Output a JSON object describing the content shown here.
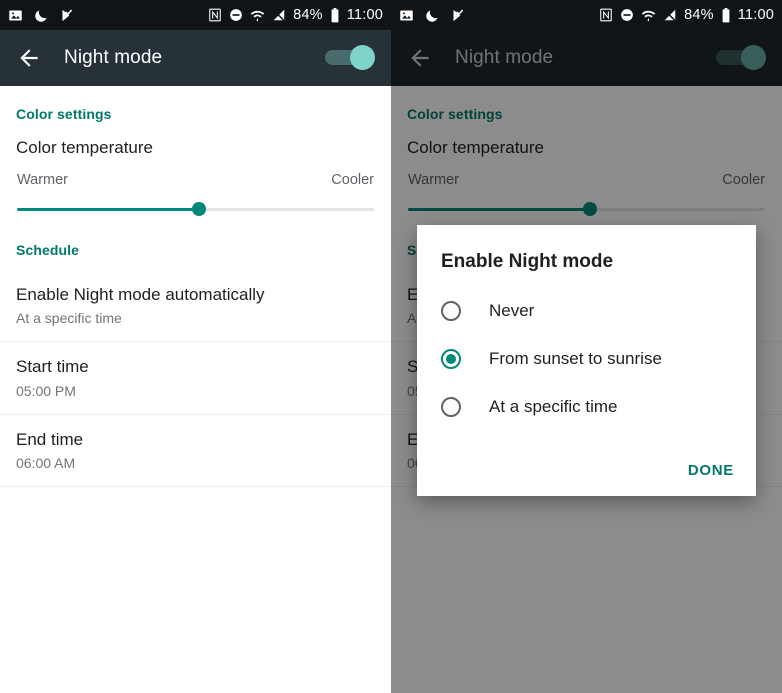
{
  "status_bar": {
    "left_icons": [
      "image-icon",
      "moon-icon",
      "flag-check-icon"
    ],
    "right_icons": [
      "nfc-icon",
      "do-not-disturb-icon",
      "wifi-icon",
      "signal-off-icon"
    ],
    "battery_percent": "84%",
    "battery_icon": "battery-icon",
    "time": "11:00"
  },
  "app_bar": {
    "back_icon": "back-arrow-icon",
    "title": "Night mode",
    "toggle_on": true
  },
  "sections": {
    "color_settings_header": "Color settings",
    "color_temperature_title": "Color temperature",
    "slider": {
      "min_label": "Warmer",
      "max_label": "Cooler",
      "value_percent": 51
    },
    "schedule_header": "Schedule"
  },
  "list_items": [
    {
      "title": "Enable Night mode automatically",
      "subtitle": "At a specific time"
    },
    {
      "title": "Start time",
      "subtitle": "05:00 PM"
    },
    {
      "title": "End time",
      "subtitle": "06:00 AM"
    }
  ],
  "dialog": {
    "title": "Enable Night mode",
    "options": [
      {
        "label": "Never",
        "selected": false
      },
      {
        "label": "From sunset to sunrise",
        "selected": true
      },
      {
        "label": "At a specific time",
        "selected": false
      }
    ],
    "done_label": "DONE"
  },
  "colors": {
    "accent": "#00796B",
    "slider_accent": "#00897B",
    "app_bar": "#263238",
    "status_bar": "#111416",
    "toggle_thumb": "#7fd4c9"
  }
}
